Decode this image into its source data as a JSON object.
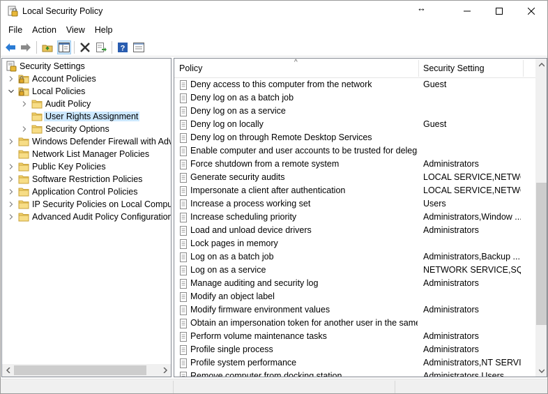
{
  "window": {
    "title": "Local Security Policy",
    "resize_glyph": "↔"
  },
  "menu": [
    "File",
    "Action",
    "View",
    "Help"
  ],
  "toolbar": {
    "buttons": [
      "back-icon",
      "forward-icon",
      "up-folder-icon",
      "show-hide-tree-icon",
      "delete-icon",
      "export-list-icon",
      "help-icon",
      "properties-icon"
    ]
  },
  "tree": {
    "root": "Security Settings",
    "items": [
      {
        "label": "Account Policies",
        "level": 1,
        "expand": "collapsed"
      },
      {
        "label": "Local Policies",
        "level": 1,
        "expand": "expanded"
      },
      {
        "label": "Audit Policy",
        "level": 2,
        "expand": "collapsed"
      },
      {
        "label": "User Rights Assignment",
        "level": 2,
        "expand": "none",
        "selected": true
      },
      {
        "label": "Security Options",
        "level": 2,
        "expand": "collapsed"
      },
      {
        "label": "Windows Defender Firewall with Adva",
        "level": 1,
        "expand": "collapsed"
      },
      {
        "label": "Network List Manager Policies",
        "level": 1,
        "expand": "none"
      },
      {
        "label": "Public Key Policies",
        "level": 1,
        "expand": "collapsed"
      },
      {
        "label": "Software Restriction Policies",
        "level": 1,
        "expand": "collapsed"
      },
      {
        "label": "Application Control Policies",
        "level": 1,
        "expand": "collapsed"
      },
      {
        "label": "IP Security Policies on Local Compute",
        "level": 1,
        "expand": "collapsed"
      },
      {
        "label": "Advanced Audit Policy Configuration",
        "level": 1,
        "expand": "collapsed"
      }
    ]
  },
  "list": {
    "columns": [
      "Policy",
      "Security Setting"
    ],
    "sort_caret": "^",
    "rows": [
      {
        "policy": "Deny access to this computer from the network",
        "setting": "Guest"
      },
      {
        "policy": "Deny log on as a batch job",
        "setting": ""
      },
      {
        "policy": "Deny log on as a service",
        "setting": ""
      },
      {
        "policy": "Deny log on locally",
        "setting": "Guest"
      },
      {
        "policy": "Deny log on through Remote Desktop Services",
        "setting": ""
      },
      {
        "policy": "Enable computer and user accounts to be trusted for delega...",
        "setting": ""
      },
      {
        "policy": "Force shutdown from a remote system",
        "setting": "Administrators"
      },
      {
        "policy": "Generate security audits",
        "setting": "LOCAL SERVICE,NETWO..."
      },
      {
        "policy": "Impersonate a client after authentication",
        "setting": "LOCAL SERVICE,NETWO..."
      },
      {
        "policy": "Increase a process working set",
        "setting": "Users"
      },
      {
        "policy": "Increase scheduling priority",
        "setting": "Administrators,Window ..."
      },
      {
        "policy": "Load and unload device drivers",
        "setting": "Administrators"
      },
      {
        "policy": "Lock pages in memory",
        "setting": ""
      },
      {
        "policy": "Log on as a batch job",
        "setting": "Administrators,Backup ..."
      },
      {
        "policy": "Log on as a service",
        "setting": "NETWORK SERVICE,SQL..."
      },
      {
        "policy": "Manage auditing and security log",
        "setting": "Administrators"
      },
      {
        "policy": "Modify an object label",
        "setting": ""
      },
      {
        "policy": "Modify firmware environment values",
        "setting": "Administrators"
      },
      {
        "policy": "Obtain an impersonation token for another user in the same...",
        "setting": ""
      },
      {
        "policy": "Perform volume maintenance tasks",
        "setting": "Administrators"
      },
      {
        "policy": "Profile single process",
        "setting": "Administrators"
      },
      {
        "policy": "Profile system performance",
        "setting": "Administrators,NT SERVI..."
      },
      {
        "policy": "Remove computer from docking station",
        "setting": "Administrators,Users"
      }
    ]
  },
  "colors": {
    "selection": "#cce8ff",
    "folder": "#f3d26b",
    "accent_blue": "#1e6fc8"
  }
}
